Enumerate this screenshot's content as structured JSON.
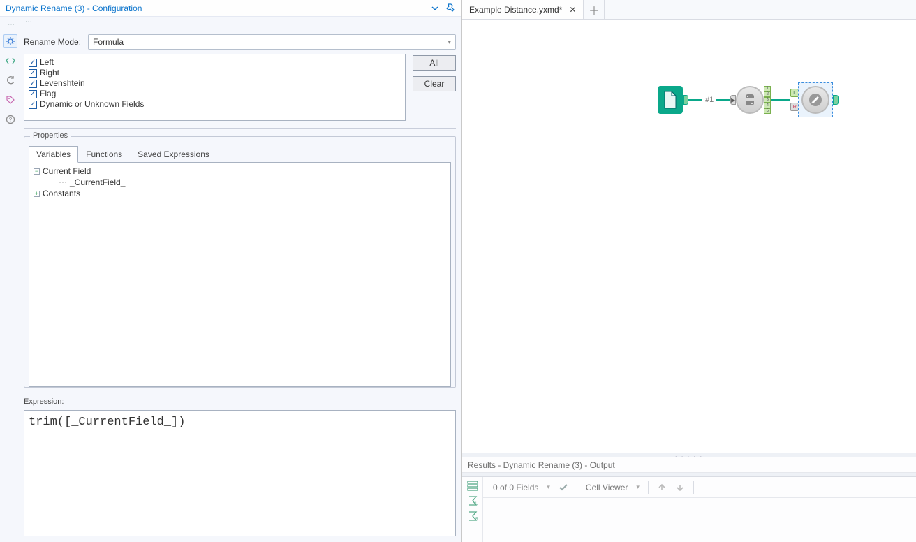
{
  "config": {
    "title": "Dynamic Rename (3) - Configuration",
    "rename_label": "Rename Mode:",
    "rename_value": "Formula",
    "checkboxes": [
      "Left",
      "Right",
      "Levenshtein",
      "Flag",
      "Dynamic or Unknown Fields"
    ],
    "buttons": {
      "all": "All",
      "clear": "Clear"
    },
    "properties_label": "Properties",
    "tabs": {
      "variables": "Variables",
      "functions": "Functions",
      "saved": "Saved Expressions"
    },
    "tree": {
      "current_field": "Current Field",
      "current_field_item": "_CurrentField_",
      "constants": "Constants"
    },
    "expression_label": "Expression:",
    "expression_value": "trim([_CurrentField_])"
  },
  "document": {
    "tab_name": "Example Distance.yxmd*"
  },
  "workflow": {
    "anno1": "#1",
    "multi_ports": [
      "1",
      "2",
      "3",
      "4",
      "5"
    ],
    "lr_l": "L",
    "lr_r": "R"
  },
  "results": {
    "header": "Results - Dynamic Rename (3) - Output",
    "fields_text": "0 of 0 Fields",
    "cell_viewer": "Cell Viewer"
  }
}
